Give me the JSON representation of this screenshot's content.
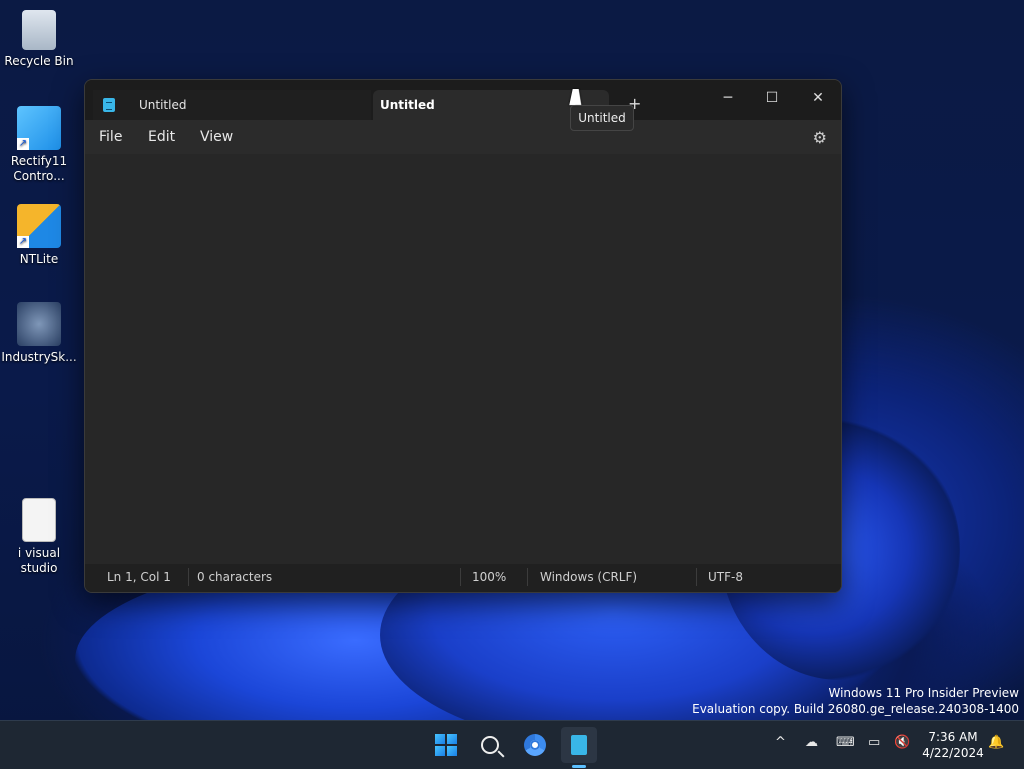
{
  "desktop": {
    "icons": [
      {
        "label": "Recycle Bin"
      },
      {
        "label": "Rectify11 Contro..."
      },
      {
        "label": "NTLite"
      },
      {
        "label": "IndustrySk..."
      },
      {
        "label": "i visual studio"
      }
    ],
    "watermark": {
      "line1": "Windows 11 Pro Insider Preview",
      "line2": "Evaluation copy. Build 26080.ge_release.240308-1400"
    }
  },
  "notepad": {
    "tabs": [
      {
        "label": "Untitled"
      },
      {
        "label": "Untitled"
      }
    ],
    "new_tab": "+",
    "tooltip": "Untitled",
    "menu": {
      "file": "File",
      "edit": "Edit",
      "view": "View"
    },
    "caption": {
      "minimize": "─",
      "maximize": "☐",
      "close": "✕"
    },
    "status": {
      "position": "Ln 1, Col 1",
      "characters": "0 characters",
      "zoom": "100%",
      "line_ending": "Windows (CRLF)",
      "encoding": "UTF-8"
    }
  },
  "taskbar": {
    "tray": {
      "chevron": "^"
    },
    "clock": {
      "time": "7:36 AM",
      "date": "4/22/2024"
    }
  },
  "colors": {
    "accent": "#39b6e8",
    "window_bg": "#202020"
  }
}
